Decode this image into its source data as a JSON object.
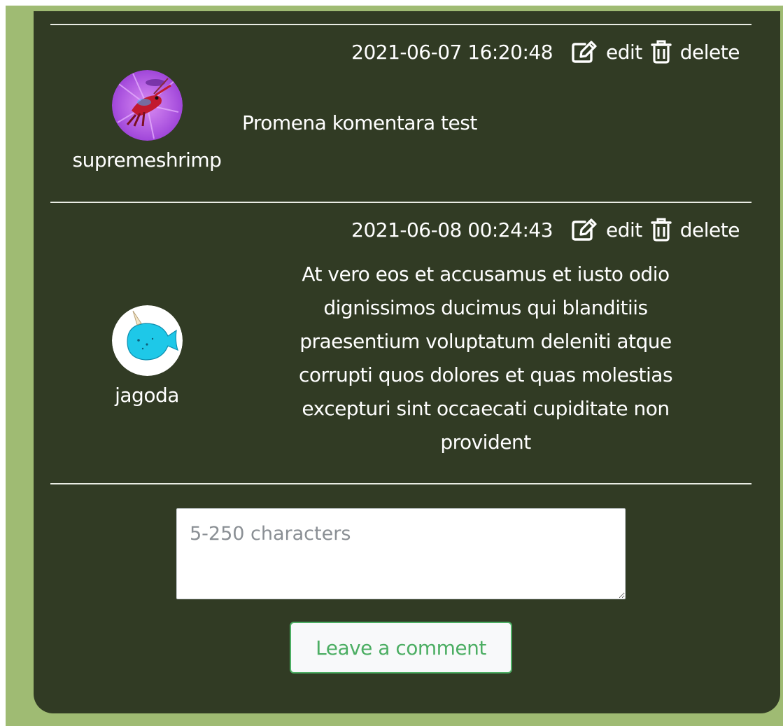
{
  "comments": [
    {
      "author": "supremeshrimp",
      "timestamp": "2021-06-07 16:20:48",
      "edit_label": "edit",
      "delete_label": "delete",
      "text": "Promena komentara test",
      "avatar_icon": "shrimp-avatar-icon"
    },
    {
      "author": "jagoda",
      "timestamp": "2021-06-08 00:24:43",
      "edit_label": "edit",
      "delete_label": "delete",
      "text": "At vero eos et accusamus et iusto odio dignissimos ducimus qui blanditiis praesentium voluptatum deleniti atque corrupti quos dolores et quas molestias excepturi sint occaecati cupiditate non provident",
      "avatar_icon": "narwhal-avatar-icon"
    }
  ],
  "form": {
    "comment_value": "",
    "comment_placeholder": "5-250 characters",
    "submit_label": "Leave a comment"
  },
  "colors": {
    "page_background": "#9fbb73",
    "card_background": "#313b24",
    "accent": "#4cae63"
  }
}
